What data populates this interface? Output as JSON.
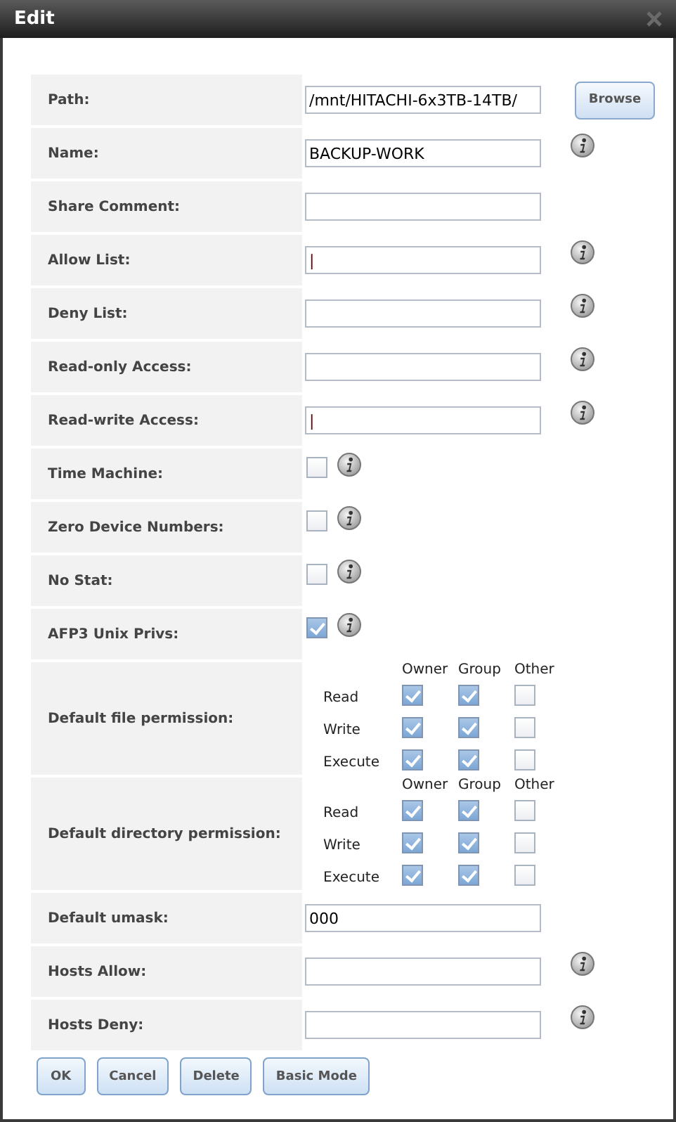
{
  "window": {
    "title": "Edit"
  },
  "fields": [
    {
      "kind": "text",
      "label": "Path:",
      "value": "/mnt/HITACHI-6x3TB-14TB/",
      "info": false,
      "browse": "Browse"
    },
    {
      "kind": "text",
      "label": "Name:",
      "value": "BACKUP-WORK",
      "info": true
    },
    {
      "kind": "text",
      "label": "Share Comment:",
      "info": false
    },
    {
      "kind": "text",
      "label": "Allow List:",
      "value": "|",
      "info": true
    },
    {
      "kind": "text",
      "label": "Deny List:",
      "info": true
    },
    {
      "kind": "text",
      "label": "Read-only Access:",
      "info": true
    },
    {
      "kind": "text",
      "label": "Read-write Access:",
      "value": "|",
      "info": true
    },
    {
      "kind": "checkbox",
      "label": "Time Machine:",
      "checked": false,
      "info": true
    },
    {
      "kind": "checkbox",
      "label": "Zero Device Numbers:",
      "checked": false,
      "info": true
    },
    {
      "kind": "checkbox",
      "label": "No Stat:",
      "checked": false,
      "info": true
    },
    {
      "kind": "checkbox",
      "label": "AFP3 Unix Privs:",
      "checked": true,
      "info": true
    },
    {
      "kind": "permissions",
      "label": "Default file permission:",
      "columns": [
        "Owner",
        "Group",
        "Other"
      ],
      "rows": [
        {
          "label": "Read",
          "checks": [
            true,
            true,
            false
          ]
        },
        {
          "label": "Write",
          "checks": [
            true,
            true,
            false
          ]
        },
        {
          "label": "Execute",
          "checks": [
            true,
            true,
            false
          ]
        }
      ]
    },
    {
      "kind": "permissions",
      "label": "Default directory permission:",
      "columns": [
        "Owner",
        "Group",
        "Other"
      ],
      "rows": [
        {
          "label": "Read",
          "checks": [
            true,
            true,
            false
          ]
        },
        {
          "label": "Write",
          "checks": [
            true,
            true,
            false
          ]
        },
        {
          "label": "Execute",
          "checks": [
            true,
            true,
            false
          ]
        }
      ]
    },
    {
      "kind": "text",
      "label": "Default umask:",
      "value": "000",
      "info": false
    },
    {
      "kind": "text",
      "label": "Hosts Allow:",
      "info": true
    },
    {
      "kind": "text",
      "label": "Hosts Deny:",
      "info": true
    }
  ],
  "buttons": [
    "OK",
    "Cancel",
    "Delete",
    "Basic Mode"
  ]
}
